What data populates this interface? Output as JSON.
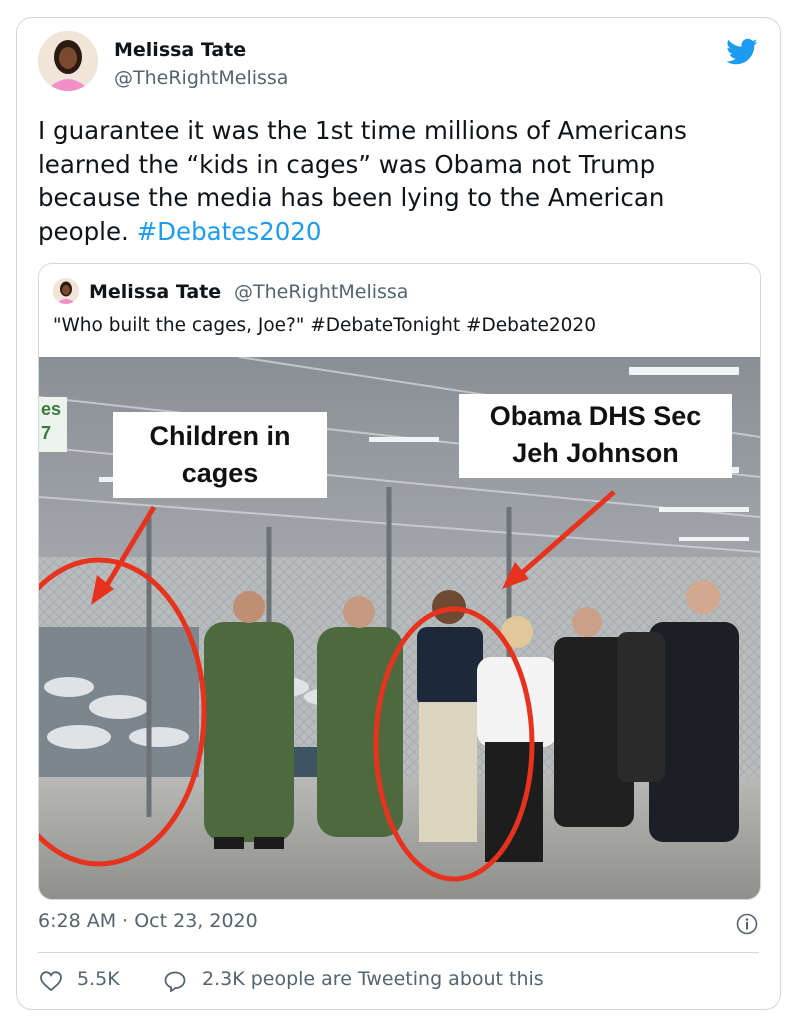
{
  "tweet": {
    "author_name": "Melissa Tate",
    "author_handle": "@TheRightMelissa",
    "text_main": "I guarantee it was the 1st time millions of Americans learned the “kids in cages” was Obama not Trump because the media has been lying to the American people. ",
    "hashtag": "#Debates2020",
    "timestamp": "6:28 AM · Oct 23, 2020",
    "likes": "5.5K",
    "retweet_text": "2.3K people are Tweeting about this",
    "icons": [
      "twitter-bird-icon",
      "info-icon",
      "heart-icon",
      "reply-bubble-icon"
    ],
    "accent_color": "#1d9bf0"
  },
  "quoted": {
    "author_name": "Melissa Tate",
    "author_handle": "@TheRightMelissa",
    "text": "\"Who built the cages, Joe?\" #DebateTonight #Debate2020",
    "image_labels": {
      "left_label_line1": "Children in",
      "left_label_line2": "cages",
      "right_label_line1": "Obama DHS Sec",
      "right_label_line2": "Jeh Johnson"
    },
    "sign_text": "es\n7"
  }
}
